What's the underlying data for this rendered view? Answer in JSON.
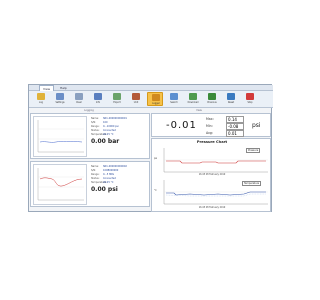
{
  "menu": {
    "tabs": [
      "View",
      "Help"
    ],
    "active": 0
  },
  "ribbon": {
    "buttons": [
      {
        "label": "Log",
        "icon": "log-icon",
        "color": "#e0b33a"
      },
      {
        "label": "Settings",
        "icon": "settings-icon",
        "color": "#6b8fc7"
      },
      {
        "label": "Clear",
        "icon": "clear-icon",
        "color": "#8aa0c0"
      },
      {
        "label": "Info",
        "icon": "info-icon",
        "color": "#5a7fbf"
      },
      {
        "label": "Export",
        "icon": "export-icon",
        "color": "#6aa36a"
      },
      {
        "label": "Unit",
        "icon": "unit-icon",
        "color": "#b35a3a"
      },
      {
        "label": "Logger",
        "icon": "logger-icon",
        "color": "#d08a1e"
      },
      {
        "label": "Search",
        "icon": "search-icon",
        "color": "#5b8fd0"
      },
      {
        "label": "Download",
        "icon": "download-icon",
        "color": "#4e9a4e"
      },
      {
        "label": "Previous",
        "icon": "previous-icon",
        "color": "#3a8a3a"
      },
      {
        "label": "Reset",
        "icon": "reset-icon",
        "color": "#3a7ac0"
      },
      {
        "label": "Stop",
        "icon": "stop-icon",
        "color": "#d23a3a"
      }
    ],
    "active_index": 6,
    "groups": [
      "Logging",
      "View"
    ]
  },
  "devices": [
    {
      "rows": [
        {
          "k": "Name:",
          "v": "SN1-000000000001"
        },
        {
          "k": "S/N:",
          "v": "100"
        },
        {
          "k": "Range:",
          "v": "0...10000 psi"
        },
        {
          "k": "Status:",
          "v": "Connected"
        },
        {
          "k": "Temperature:",
          "v": "26.25 °C"
        }
      ],
      "value": "0.00 bar"
    },
    {
      "rows": [
        {
          "k": "Name:",
          "v": "SN1-000000000002"
        },
        {
          "k": "S/N:",
          "v": "100B000000"
        },
        {
          "k": "Range:",
          "v": "0...5 MPa"
        },
        {
          "k": "Status:",
          "v": "Connected"
        },
        {
          "k": "Temperature:",
          "v": "26.25 °C"
        }
      ],
      "value": "0.00 psi"
    }
  ],
  "readout": {
    "main_value": "-0.01",
    "max_label": "Max:",
    "max_value": "0.14",
    "min_label": "Min:",
    "min_value": "-0.08",
    "avg_label": "Avg:",
    "avg_value": "0.01",
    "unit": "psi"
  },
  "pressure_chart": {
    "title": "Pressure Chart",
    "legend1": "Pressure",
    "legend2": "Temperature",
    "ylabel1": "psi",
    "ylabel2": "°C",
    "xtick1": "16:45 28 February 2019",
    "xtick2": "16:45 28 February 2019"
  }
}
